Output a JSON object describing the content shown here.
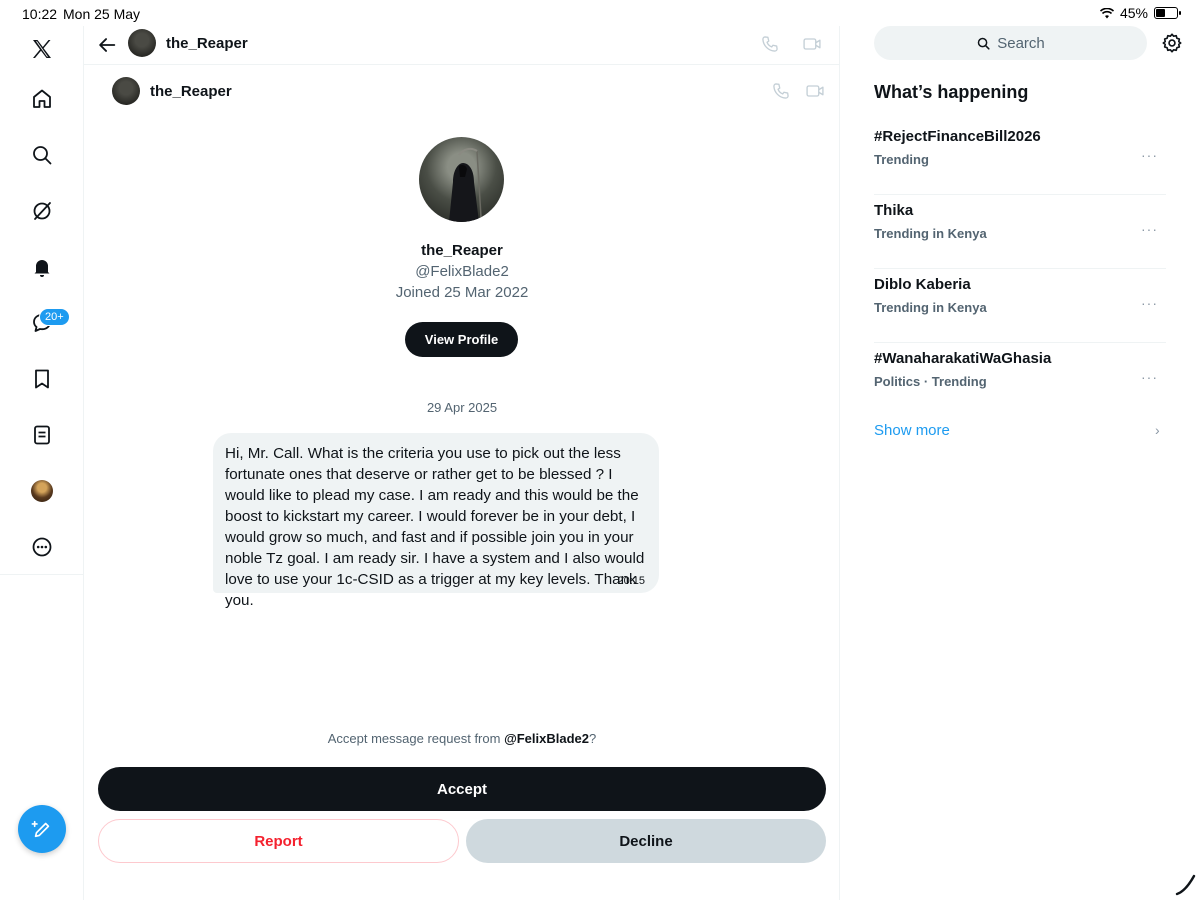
{
  "status_bar": {
    "time": "10:22",
    "date": "Mon 25 May",
    "battery_pct": "45%",
    "battery_level": 0.45
  },
  "nav": {
    "items": [
      "x-logo-icon",
      "home-icon",
      "search-icon",
      "grok-icon",
      "notifications-icon",
      "messages-icon",
      "bookmarks-icon",
      "lists-icon",
      "profile-avatar",
      "more-icon"
    ],
    "messages_badge": "20+"
  },
  "conversation": {
    "name": "the_Reaper",
    "handle": "@FelixBlade2",
    "joined": "Joined 25 Mar 2022",
    "view_profile_label": "View Profile",
    "date": "29 Apr 2025",
    "message": {
      "text": "Hi, Mr. Call. What is the criteria you use to pick out the less fortunate ones that deserve or rather get to be blessed ? I would like to plead my case. I am ready and this would be the boost to kickstart my career. I would forever be in your debt, I would grow so much, and fast and if possible join you in your noble Tz goal. I am ready sir. I have a system and I also would love to use your 1c-CSID as a trigger at my key levels. Thank you.",
      "time": "20:15"
    },
    "request_prefix": "Accept message request from ",
    "request_handle": "@FelixBlade2",
    "request_suffix": "?",
    "accept_label": "Accept",
    "report_label": "Report",
    "decline_label": "Decline"
  },
  "sidebar": {
    "search_placeholder": "Search",
    "title": "What’s happening",
    "trends": [
      {
        "name": "#RejectFinanceBill2026",
        "context": "Trending"
      },
      {
        "name": "Thika",
        "context": "Trending in Kenya"
      },
      {
        "name": "Diblo Kaberia",
        "context": "Trending in Kenya"
      },
      {
        "name": "#WanaharakatiWaGhasia",
        "context": "Politics · Trending"
      }
    ],
    "more_glyph": "···",
    "show_more": "Show more",
    "show_more_chevron": "›"
  },
  "colors": {
    "accent": "#1d9bf0",
    "dark": "#0f1419",
    "muted": "#536471",
    "danger": "#f4212e"
  }
}
